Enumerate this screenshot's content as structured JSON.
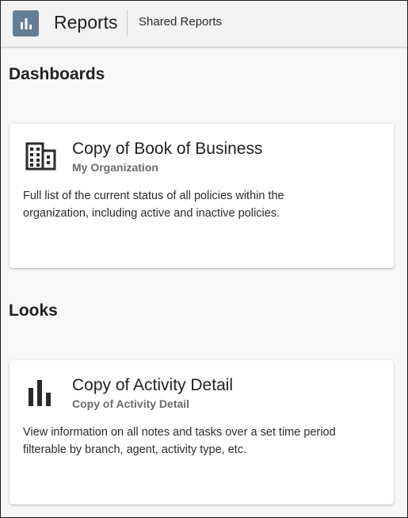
{
  "header": {
    "app_title": "Reports",
    "breadcrumb": "Shared Reports",
    "app_icon": "bar-chart-icon",
    "accent_color": "#637f96"
  },
  "sections": {
    "dashboards": {
      "heading": "Dashboards",
      "card": {
        "icon": "building-icon",
        "title": "Copy of Book of Business",
        "subtitle": "My Organization",
        "description": "Full list of the current status of all policies within the organization, including active and inactive policies."
      }
    },
    "looks": {
      "heading": "Looks",
      "card": {
        "icon": "bar-chart-icon",
        "title": "Copy of Activity Detail",
        "subtitle": "Copy of Activity Detail",
        "description": "View information on all notes and tasks over a set time period filterable by branch, agent, activity type, etc."
      }
    }
  }
}
